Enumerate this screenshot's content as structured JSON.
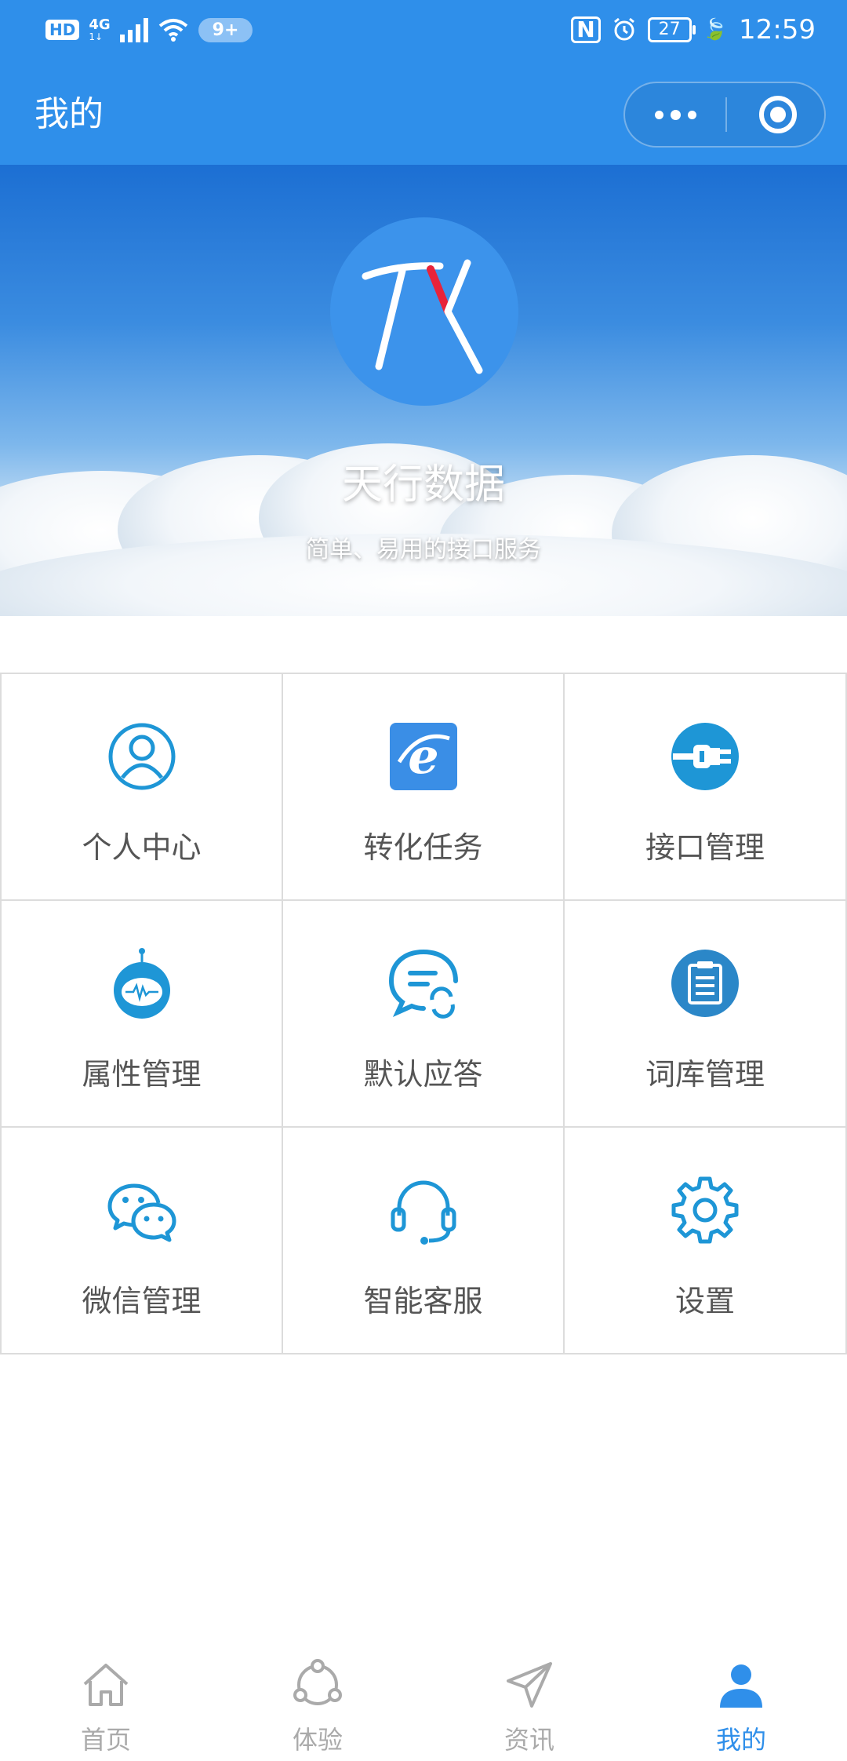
{
  "status_bar": {
    "hd": "HD",
    "network": "4G",
    "network_sub": "1↓",
    "notification_badge": "9+",
    "nfc": "N",
    "battery": "27",
    "time": "12:59"
  },
  "nav": {
    "title": "我的",
    "more_icon": "more-dots-icon",
    "close_icon": "target-close-icon"
  },
  "hero": {
    "brand_title": "天行数据",
    "brand_subtitle": "简单、易用的接口服务",
    "logo_text": "TX"
  },
  "grid": [
    {
      "label": "个人中心",
      "icon": "user-icon"
    },
    {
      "label": "转化任务",
      "icon": "ie-browser-icon"
    },
    {
      "label": "接口管理",
      "icon": "plug-icon"
    },
    {
      "label": "属性管理",
      "icon": "robot-icon"
    },
    {
      "label": "默认应答",
      "icon": "chat-refresh-icon"
    },
    {
      "label": "词库管理",
      "icon": "clipboard-icon"
    },
    {
      "label": "微信管理",
      "icon": "wechat-icon"
    },
    {
      "label": "智能客服",
      "icon": "headset-icon"
    },
    {
      "label": "设置",
      "icon": "gear-icon"
    }
  ],
  "tabs": [
    {
      "label": "首页",
      "icon": "home-icon",
      "active": false
    },
    {
      "label": "体验",
      "icon": "share-icon",
      "active": false
    },
    {
      "label": "资讯",
      "icon": "paper-plane-icon",
      "active": false
    },
    {
      "label": "我的",
      "icon": "person-icon",
      "active": true
    }
  ],
  "colors": {
    "primary": "#2f8fea",
    "icon_blue": "#1e96d6",
    "tab_inactive": "#aaaaaa",
    "grid_line": "#dcdcdc",
    "label_text": "#555555"
  }
}
